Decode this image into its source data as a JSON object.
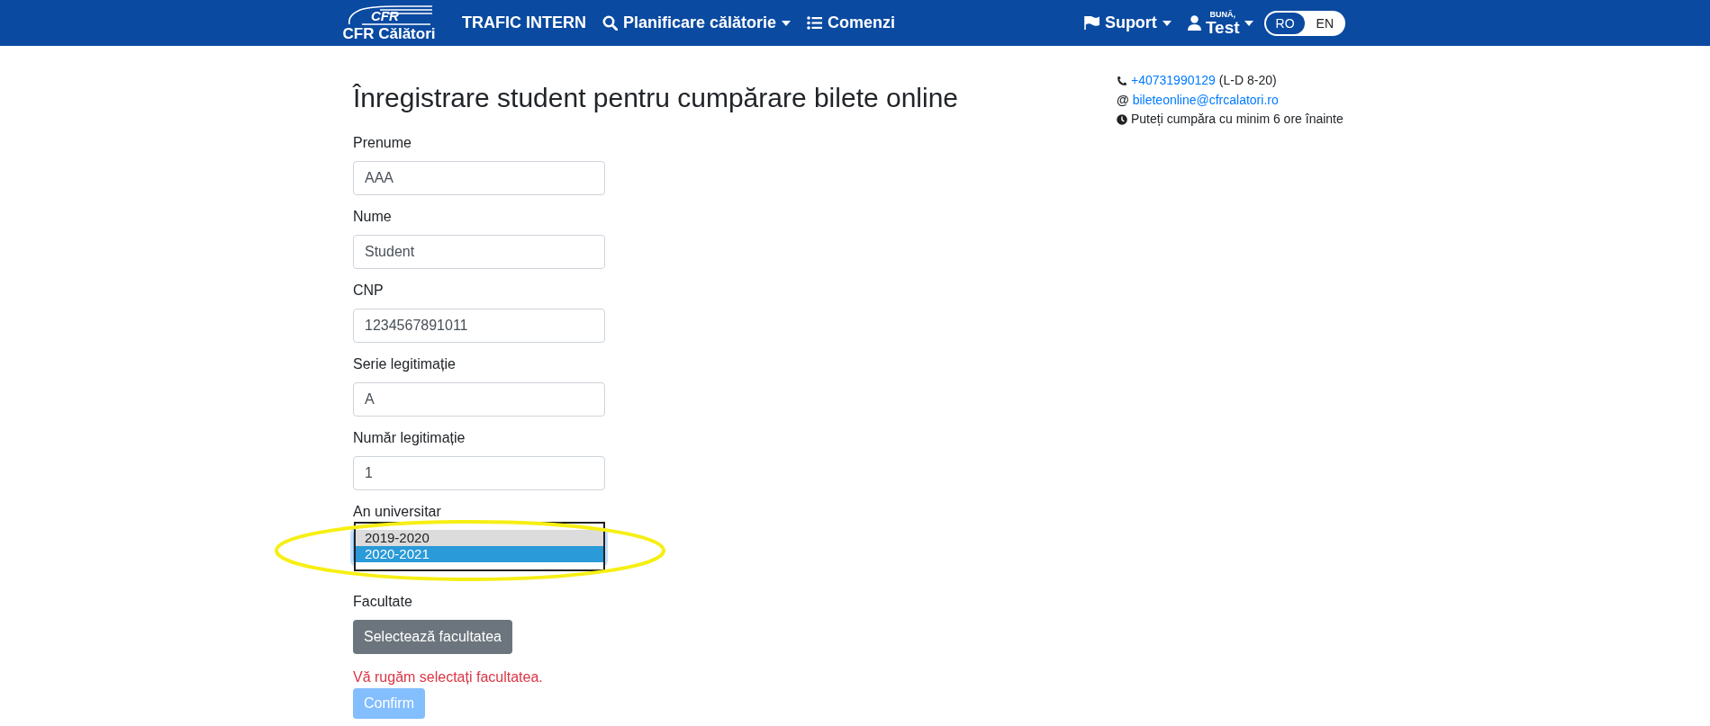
{
  "navbar": {
    "logo": {
      "mark": "CFR",
      "name": "CFR Călători"
    },
    "items": [
      {
        "label": "TRAFIC INTERN",
        "kind": "plain"
      },
      {
        "label": "Planificare călătorie",
        "kind": "search-dropdown"
      },
      {
        "label": "Comenzi",
        "kind": "list"
      }
    ],
    "support": "Suport",
    "user": {
      "greeting": "BUNĂ,",
      "name": "Test"
    },
    "languages": [
      {
        "label": "RO",
        "selected": true
      },
      {
        "label": "EN",
        "selected": false
      }
    ]
  },
  "title": "Înregistrare student pentru cumpărare bilete online",
  "contact": [
    {
      "kind": "phone",
      "link": "+40731990129",
      "text": "(L-D 8-20)"
    },
    {
      "kind": "email",
      "symbol": "@",
      "link": "bileteonline@cfrcalatori.ro"
    },
    {
      "kind": "clock",
      "text": "Puteți cumpăra cu minim 6 ore înainte"
    }
  ],
  "fields": [
    {
      "label": "Prenume",
      "value": "AAA"
    },
    {
      "label": "Nume",
      "value": "Student"
    },
    {
      "label": "CNP",
      "value": "1234567891011"
    },
    {
      "label": "Serie legitimație",
      "value": "A"
    },
    {
      "label": "Număr legitimație",
      "value": "1"
    }
  ],
  "year": {
    "label": "An universitar",
    "options": [
      {
        "label": "2019-2020",
        "selected": false,
        "hovered": true
      },
      {
        "label": "2020-2021",
        "selected": true,
        "hovered": false
      }
    ]
  },
  "faculty": {
    "label": "Facultate",
    "button": "Selectează facultatea",
    "error": "Vă rugăm selectați facultatea."
  },
  "confirm": {
    "label": "Confirm",
    "disabled": true
  },
  "annotation": {
    "kind": "ellipse"
  }
}
